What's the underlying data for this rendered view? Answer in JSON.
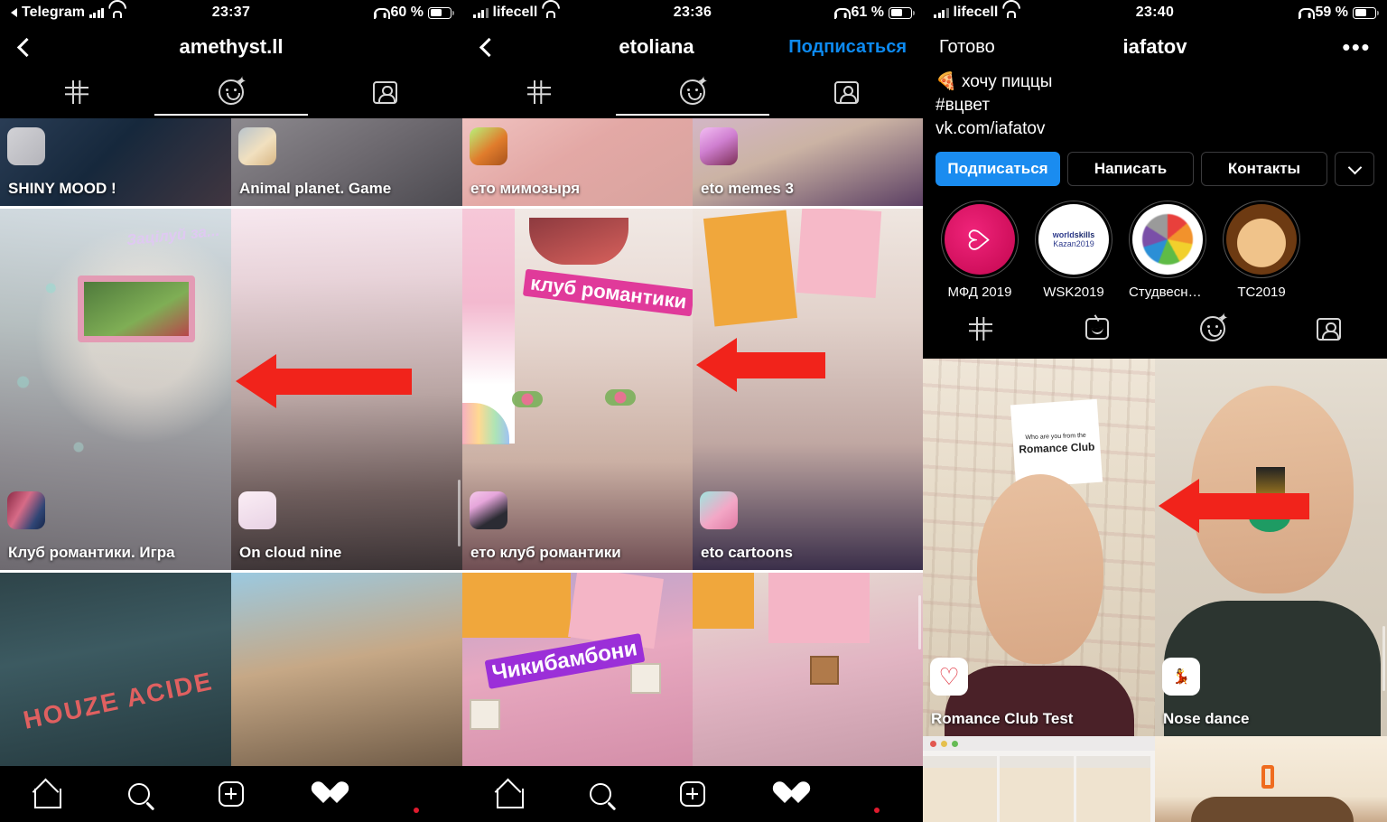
{
  "panels": [
    {
      "id": "panel-amethyst",
      "status": {
        "carrier": "Telegram",
        "back_glyph": "◀",
        "time": "23:37",
        "battery": "60 %",
        "battery_level": 60,
        "headphones": true,
        "wifi": true
      },
      "nav": {
        "back": "back-chevron",
        "title": "amethyst.ll",
        "action": ""
      },
      "tabs": [
        {
          "name": "grid",
          "active": false
        },
        {
          "name": "effects",
          "active": true
        },
        {
          "name": "tagged",
          "active": false
        }
      ],
      "rows": [
        {
          "partial": "top",
          "cells": [
            {
              "label": "SHINY MOOD !",
              "thumb_colors": [
                "#cfcfd2",
                "#b9b9bd"
              ]
            },
            {
              "label": "Animal planet. Game",
              "thumb_colors": [
                "#f4e4c8",
                "#e0c79a"
              ]
            }
          ]
        },
        {
          "selected": true,
          "cells": [
            {
              "label": "Клуб романтики. Игра",
              "thumb_colors": [
                "#7a2f4a",
                "#2c3f6e"
              ],
              "overlay_text": "Зацілуй за..."
            },
            {
              "label": "On cloud nine",
              "thumb_colors": [
                "#f5dbe6",
                "#e6c3d6"
              ],
              "arrow": true
            }
          ]
        },
        {
          "partial": "bottom",
          "cells": [
            {
              "label": "",
              "overlay_text": "HOUZE ACIDE"
            },
            {
              "label": ""
            }
          ]
        }
      ],
      "bottom_nav": [
        "home-icon",
        "search-icon",
        "add-post-icon",
        "activity-heart-icon",
        "profile-avatar"
      ]
    },
    {
      "id": "panel-etoliana",
      "status": {
        "carrier": "lifecell",
        "back_glyph": "",
        "time": "23:36",
        "battery": "61 %",
        "battery_level": 61,
        "headphones": true,
        "wifi": true
      },
      "nav": {
        "back": "back-chevron",
        "title": "etoliana",
        "action": "Подписаться"
      },
      "tabs": [
        {
          "name": "grid",
          "active": false
        },
        {
          "name": "effects",
          "active": true
        },
        {
          "name": "tagged",
          "active": false
        }
      ],
      "rows": [
        {
          "partial": "top",
          "cells": [
            {
              "label": "ето мимозыря",
              "thumb_colors": [
                "#b6f26a",
                "#e07b2a"
              ]
            },
            {
              "label": "eto memes 3",
              "thumb_colors": [
                "#f0b8f0",
                "#8a3a6a"
              ]
            }
          ]
        },
        {
          "selected": true,
          "cells": [
            {
              "label": "ето клуб романтики",
              "thumb_colors": [
                "#f3c3e6",
                "#2b2b33"
              ],
              "overlay_text": "клуб романтики"
            },
            {
              "label": "eto cartoons",
              "thumb_colors": [
                "#9fe6e0",
                "#f49ac1"
              ],
              "arrow": true
            }
          ]
        },
        {
          "partial": "bottom",
          "cells": [
            {
              "label": "",
              "overlay_text": "Чикибамбони"
            },
            {
              "label": ""
            }
          ]
        }
      ],
      "bottom_nav": [
        "home-icon",
        "search-icon",
        "add-post-icon",
        "activity-heart-icon",
        "profile-avatar"
      ]
    },
    {
      "id": "panel-iafatov",
      "status": {
        "carrier": "lifecell",
        "back_glyph": "",
        "time": "23:40",
        "battery": "59 %",
        "battery_level": 59,
        "headphones": true,
        "wifi": true
      },
      "nav": {
        "back_label": "Готово",
        "title": "iafatov",
        "more": "more-options"
      },
      "bio": {
        "emoji": "🍕",
        "line1": "хочу пиццы",
        "line2": "#вцвет",
        "line3": "vk.com/iafatov"
      },
      "buttons": {
        "follow": "Подписаться",
        "message": "Написать",
        "contact": "Контакты",
        "more": "chevron-down"
      },
      "highlights": [
        {
          "name": "МФД 2019",
          "colors": [
            "#e0156d",
            "#b0114f"
          ]
        },
        {
          "name": "WSK2019",
          "colors": [
            "#ffffff",
            "#e8e8e8"
          ]
        },
        {
          "name": "Студвесна...",
          "colors": [
            "#ffffff",
            "#f2f2f2"
          ]
        },
        {
          "name": "ТС2019",
          "colors": [
            "#f7e6cf",
            "#c98a3a"
          ]
        }
      ],
      "tabs": [
        {
          "name": "grid",
          "active": true
        },
        {
          "name": "igtv",
          "active": false
        },
        {
          "name": "effects",
          "active": false
        },
        {
          "name": "tagged",
          "active": false
        }
      ],
      "rows": [
        {
          "selected": false,
          "cells": [
            {
              "label": "Romance Club Test",
              "thumb_colors": [
                "#ffffff",
                "#f2f2f2"
              ],
              "overlay_text": "Who are you from the Romance Club"
            },
            {
              "label": "Nose dance",
              "thumb_colors": [
                "#ffffff",
                "#eeeeee"
              ],
              "arrow": true
            }
          ]
        },
        {
          "partial": "bottom",
          "cells": [
            {
              "label": ""
            },
            {
              "label": ""
            }
          ]
        }
      ]
    }
  ]
}
